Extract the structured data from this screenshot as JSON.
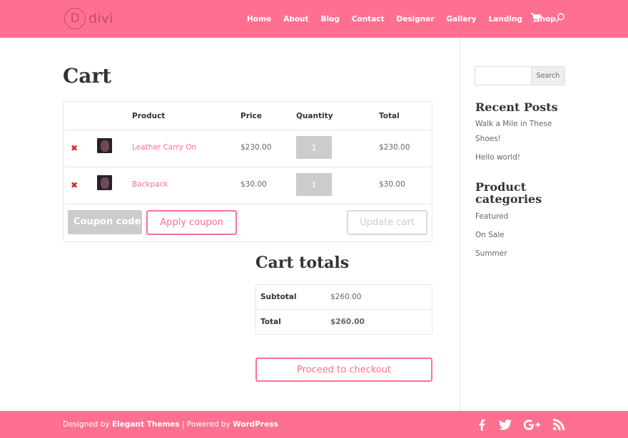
{
  "header": {
    "logo_letter": "D",
    "logo_text": "divi",
    "nav": [
      "Home",
      "About",
      "Blog",
      "Contact",
      "Designer",
      "Gallery",
      "Landing",
      "Shop"
    ],
    "icons": [
      "cart-icon",
      "search-icon"
    ]
  },
  "main": {
    "title": "Cart",
    "table": {
      "headers": [
        "Product",
        "Price",
        "Quantity",
        "Total"
      ],
      "rows": [
        {
          "remove": "✖",
          "name": "Leather Carry On",
          "price": "$230.00",
          "quantity": "1",
          "total": "$230.00"
        },
        {
          "remove": "✖",
          "name": "Backpack",
          "price": "$30.00",
          "quantity": "1",
          "total": "$30.00"
        }
      ],
      "coupon_placeholder": "Coupon code",
      "apply_label": "Apply coupon",
      "update_label": "Update cart"
    },
    "totals": {
      "title": "Cart totals",
      "subtotal_label": "Subtotal",
      "subtotal_value": "$260.00",
      "total_label": "Total",
      "total_value": "$260.00",
      "checkout_label": "Proceed to checkout"
    }
  },
  "sidebar": {
    "search_label": "Search",
    "recent_title": "Recent Posts",
    "recent_posts": [
      "Walk a Mile in These",
      "Shoes!",
      "Hello world!"
    ],
    "categories_title_1": "Product",
    "categories_title_2": "categories",
    "categories": [
      "Featured",
      "On Sale",
      "Summer"
    ]
  },
  "footer": {
    "designed_by": "Designed by ",
    "elegant": "Elegant Themes",
    "powered": " | Powered by ",
    "wordpress": "WordPress",
    "social": [
      "facebook-icon",
      "twitter-icon",
      "google-plus-icon",
      "rss-icon"
    ]
  },
  "colors": {
    "accent": "#ff7090",
    "remove": "#e02020"
  }
}
